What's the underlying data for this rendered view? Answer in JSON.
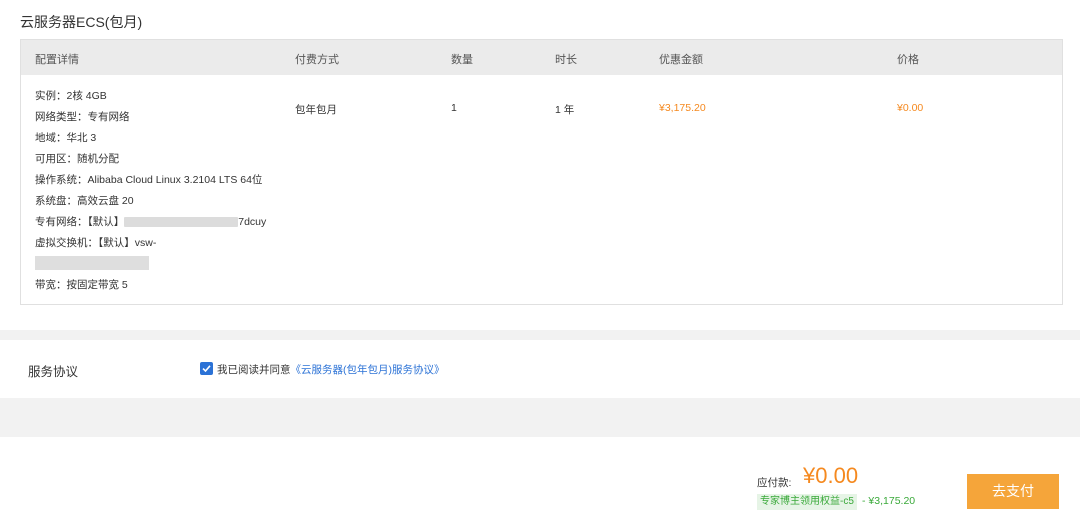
{
  "order": {
    "title": "云服务器ECS(包月)",
    "columns": [
      "配置详情",
      "付费方式",
      "数量",
      "时长",
      "优惠金额",
      "价格"
    ],
    "specs": [
      "实例：2核 4GB",
      "网络类型：专有网络",
      "地域：华北 3",
      "可用区：随机分配",
      "操作系统：Alibaba Cloud Linux 3.2104 LTS 64位",
      "系统盘：高效云盘 20"
    ],
    "vpc_label": "专有网络：【默认】",
    "vpc_suffix": "7dcuy",
    "vswitch_label": "虚拟交换机：【默认】vsw-",
    "bandwidth": "带宽：按固定带宽 5",
    "row": {
      "payment": "包年包月",
      "quantity": "1",
      "duration": "1 年",
      "discount": "¥3,175.20",
      "price": "¥0.00"
    }
  },
  "agreement": {
    "label": "服务协议",
    "checked": true,
    "text": "我已阅读并同意",
    "link": "《云服务器(包年包月)服务协议》"
  },
  "footer": {
    "pay_label": "应付款:",
    "pay_amount": "¥0.00",
    "badge": "专家博主领用权益-c5",
    "discount": "- ¥3,175.20",
    "pay_button": "去支付"
  },
  "colors": {
    "accent_orange": "#f5891f",
    "button_orange": "#f5a53a",
    "link_blue": "#2b72d6",
    "green": "#3aa93a"
  }
}
